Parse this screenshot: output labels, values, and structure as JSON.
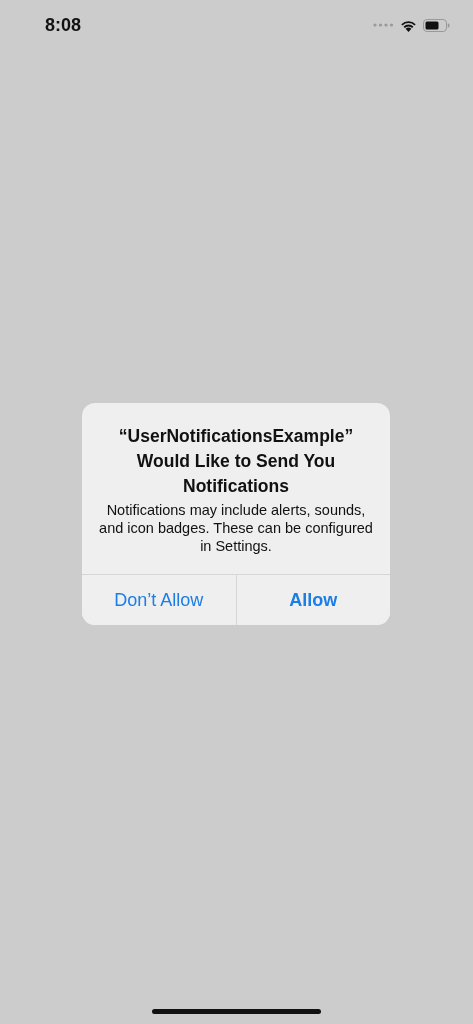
{
  "status_bar": {
    "time": "8:08"
  },
  "alert": {
    "title": "“UserNotificationsExample” Would Like to Send You Notifications",
    "message": "Notifications may include alerts, sounds, and icon badges. These can be configured in Settings.",
    "buttons": [
      {
        "label": "Don’t Allow",
        "preferred": false
      },
      {
        "label": "Allow",
        "preferred": true
      }
    ]
  }
}
